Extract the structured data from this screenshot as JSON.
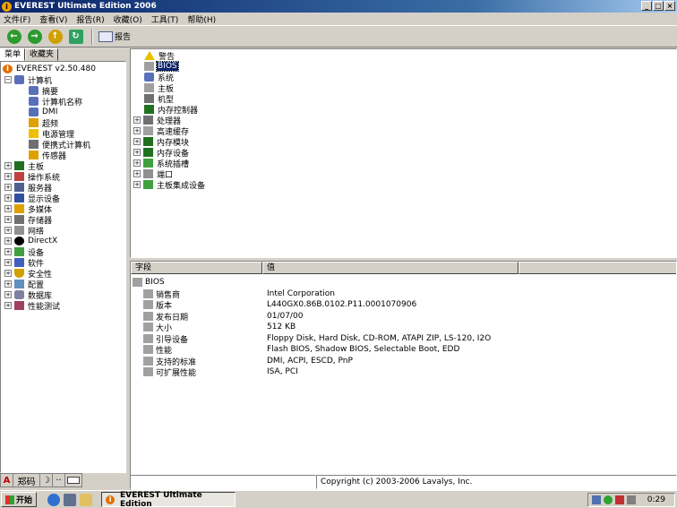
{
  "window": {
    "title": "EVEREST Ultimate Edition 2006",
    "app_icon_glyph": "i",
    "controls": [
      "_",
      "□",
      "×"
    ]
  },
  "menu": [
    "文件(F)",
    "查看(V)",
    "报告(R)",
    "收藏(O)",
    "工具(T)",
    "帮助(H)"
  ],
  "toolbar": {
    "back_glyph": "←",
    "forward_glyph": "→",
    "up_glyph": "↑",
    "refresh_glyph": "↻",
    "report_label": "报告"
  },
  "left_tabs": [
    "菜单",
    "收藏夹"
  ],
  "left_tree": {
    "root": "EVEREST v2.50.480",
    "computer": "计算机",
    "computer_children": [
      "摘要",
      "计算机名称",
      "DMI",
      "超频",
      "电源管理",
      "便携式计算机",
      "传感器"
    ],
    "categories": [
      "主板",
      "操作系统",
      "服务器",
      "显示设备",
      "多媒体",
      "存储器",
      "网络",
      "DirectX",
      "设备",
      "软件",
      "安全性",
      "配置",
      "数据库",
      "性能测试"
    ]
  },
  "top_tree": {
    "items": [
      "警告",
      "BIOS",
      "系统",
      "主板",
      "机型",
      "内存控制器"
    ],
    "expandable": [
      "处理器",
      "高速缓存",
      "内存模块",
      "内存设备",
      "系统插槽",
      "端口",
      "主板集成设备"
    ]
  },
  "detail": {
    "col_field": "字段",
    "col_value": "值",
    "group": "BIOS",
    "rows": [
      {
        "field": "销售商",
        "value": "Intel Corporation"
      },
      {
        "field": "版本",
        "value": "L440GX0.86B.0102.P11.0001070906"
      },
      {
        "field": "发布日期",
        "value": "01/07/00"
      },
      {
        "field": "大小",
        "value": "512 KB"
      },
      {
        "field": "引导设备",
        "value": "Floppy Disk, Hard Disk, CD-ROM, ATAPI ZIP, LS-120, I2O"
      },
      {
        "field": "性能",
        "value": "Flash BIOS, Shadow BIOS, Selectable Boot, EDD"
      },
      {
        "field": "支持的标准",
        "value": "DMI, ACPI, ESCD, PnP"
      },
      {
        "field": "可扩展性能",
        "value": "ISA, PCI"
      }
    ]
  },
  "status": {
    "copyright": "Copyright (c) 2003-2006 Lavalys, Inc."
  },
  "ime": {
    "lang": "A",
    "mode": "郑码",
    "moon": "☽",
    "dots": "··"
  },
  "taskbar": {
    "start_label": "开始",
    "task_label": "EVEREST Ultimate Edition",
    "clock": "0:29"
  }
}
